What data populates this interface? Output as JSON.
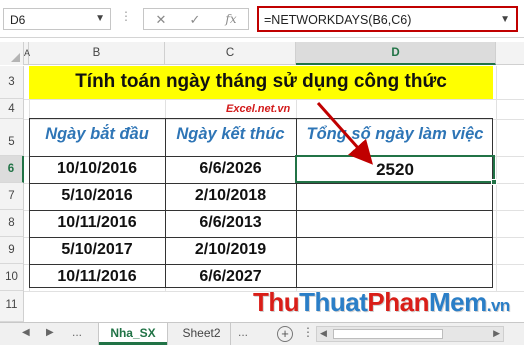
{
  "formula_bar": {
    "name_box": "D6",
    "dots": "⋮",
    "cancel_icon": "✕",
    "enter_icon": "✓",
    "fx_icon": "fx",
    "formula": "=NETWORKDAYS(B6,C6)"
  },
  "columns": [
    "A",
    "B",
    "C",
    "D"
  ],
  "active_column": "D",
  "rows": [
    "3",
    "4",
    "5",
    "6",
    "7",
    "8",
    "9",
    "10",
    "11"
  ],
  "active_row": "6",
  "sheet": {
    "title": "Tính toán ngày tháng sử dụng công thức",
    "watermark": "Excel.net.vn",
    "headers": [
      "Ngày bắt đầu",
      "Ngày kết thúc",
      "Tổng số ngày làm việc"
    ],
    "table_rows": [
      {
        "start": "10/10/2016",
        "end": "6/6/2026",
        "total": "2520"
      },
      {
        "start": "5/10/2016",
        "end": "2/10/2018",
        "total": ""
      },
      {
        "start": "10/11/2016",
        "end": "6/6/2013",
        "total": ""
      },
      {
        "start": "5/10/2017",
        "end": "2/10/2019",
        "total": ""
      },
      {
        "start": "10/11/2016",
        "end": "6/6/2027",
        "total": ""
      }
    ]
  },
  "tabs": {
    "nav_prev": "◀",
    "nav_next": "▶",
    "nav_more": "...",
    "items": [
      "Nha_SX",
      "Sheet2"
    ],
    "active": "Nha_SX",
    "add_label": "+"
  },
  "brand": {
    "part1": "Thu",
    "part2": "Thuat",
    "part3": "Phan",
    "part4": "Mem",
    "tld": ".vn"
  },
  "colors": {
    "accent": "#217346",
    "title_band": "#ffff00",
    "header_text": "#2e75b6",
    "formula_border": "#c00000",
    "arrow": "#c00000"
  }
}
